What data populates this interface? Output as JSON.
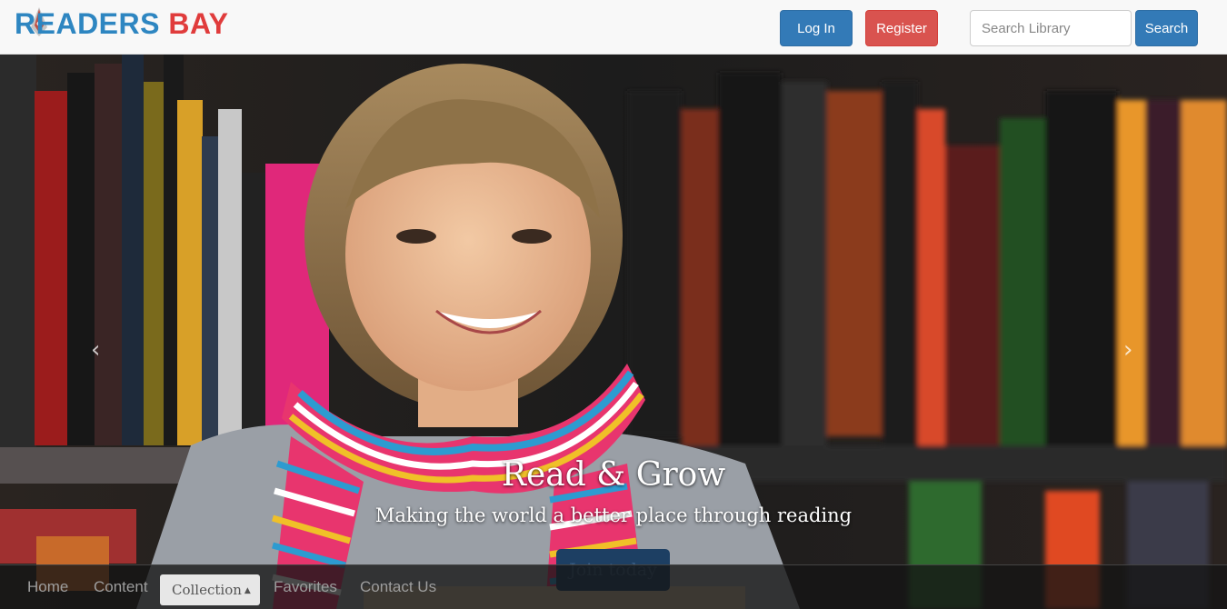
{
  "brand": {
    "name_part1": "READERS",
    "name_part2": "BAY"
  },
  "header": {
    "login_label": "Log In",
    "register_label": "Register",
    "search_placeholder": "Search Library",
    "search_label": "Search"
  },
  "carousel": {
    "prev_icon": "‹",
    "next_icon": "›",
    "title": "Read & Grow",
    "subtitle": "Making the world a better place through reading",
    "cta_label": "Join today"
  },
  "nav": {
    "items": [
      {
        "label": "Home"
      },
      {
        "label": "Content"
      },
      {
        "label": "Collection"
      },
      {
        "label": "Favorites"
      },
      {
        "label": "Contact Us"
      }
    ],
    "active_index": 2
  },
  "colors": {
    "brand_blue": "#2e86c1",
    "brand_red": "#e03c3c",
    "primary": "#337ab7",
    "danger": "#d9534f"
  },
  "icons": {
    "logo": "pen-nib-icon",
    "prev": "chevron-left-icon",
    "next": "chevron-right-icon",
    "dropdown": "caret-up-icon"
  }
}
